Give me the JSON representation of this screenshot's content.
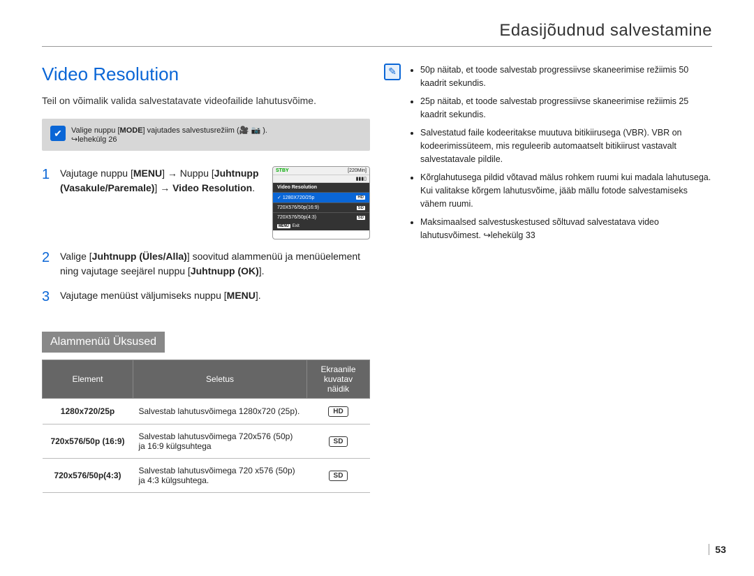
{
  "header": {
    "chapter": "Edasijõudnud salvestamine"
  },
  "title": "Video Resolution",
  "intro": "Teil on võimalik valida salvestatavate videofailide lahutusvõime.",
  "note_box": {
    "prefix": "Valige nuppu [",
    "mode": "MODE",
    "suffix": "] vajutades salvestusrežiim (",
    "icons": "🎥 📷",
    "close": " ).",
    "pageref": "↪lehekülg 26"
  },
  "steps": [
    {
      "num": "1",
      "parts": [
        "Vajutage nuppu [",
        "MENU",
        "] → Nuppu [",
        "Juhtnupp (Vasakule/Paremale)",
        "] → ",
        "Video Resolution",
        "."
      ]
    },
    {
      "num": "2",
      "parts": [
        "Valige [",
        "Juhtnupp (Üles/Alla)",
        "] soovitud alammenüü ja menüüelement ning vajutage seejärel nuppu [",
        "Juhtnupp (OK)",
        "]."
      ]
    },
    {
      "num": "3",
      "parts": [
        "Vajutage menüüst väljumiseks nuppu [",
        "MENU",
        "]."
      ]
    }
  ],
  "screen": {
    "stby": "STBY",
    "time": "[220Min]",
    "title": "Video Resolution",
    "rows": [
      {
        "label": "1280X720/25p",
        "badge": "HD",
        "selected": true,
        "checked": true
      },
      {
        "label": "720X576/50p(16:9)",
        "badge": "SD",
        "selected": false
      },
      {
        "label": "720X576/50p(4:3)",
        "badge": "SD",
        "selected": false
      }
    ],
    "exit_label": "Exit",
    "menu_label": "MENU"
  },
  "submenu_header": "Alammenüü Üksused",
  "table": {
    "headers": [
      "Element",
      "Seletus",
      "Ekraanile kuvatav näidik"
    ],
    "rows": [
      {
        "name": "1280x720/25p",
        "desc": "Salvestab lahutusvõimega 1280x720 (25p).",
        "badge": "HD"
      },
      {
        "name": "720x576/50p (16:9)",
        "desc": "Salvestab lahutusvõimega 720x576 (50p) ja 16:9 külgsuhtega",
        "badge": "SD"
      },
      {
        "name": "720x576/50p(4:3)",
        "desc": "Salvestab lahutusvõimega 720 x576 (50p) ja 4:3 külgsuhtega.",
        "badge": "SD"
      }
    ]
  },
  "right_notes": [
    "50p näitab, et toode salvestab progressiivse skaneerimise režiimis 50 kaadrit sekundis.",
    "25p näitab, et toode salvestab progressiivse skaneerimise režiimis 25 kaadrit sekundis.",
    "Salvestatud faile kodeeritakse muutuva bitikiirusega (VBR). VBR on kodeerimissüteem, mis reguleerib automaatselt bitikiirust vastavalt salvestatavale pildile.",
    "Kõrglahutusega pildid võtavad mälus rohkem ruumi kui madala lahutusega. Kui valitakse kõrgem lahutusvõime, jääb mällu fotode salvestamiseks vähem ruumi.",
    "Maksimaalsed salvestuskestused sõltuvad salvestatava video lahutusvõimest. ↪lehekülg 33"
  ],
  "pagenum": "53"
}
